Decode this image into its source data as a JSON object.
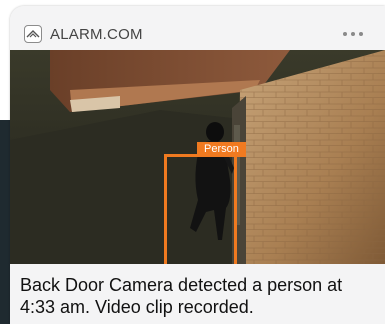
{
  "notification": {
    "app_name": "ALARM.COM",
    "app_icon": "alarm-com-logo-icon",
    "more_icon": "more-dots-icon",
    "detection_label": "Person",
    "detection_color": "#f07a20",
    "message": "Back Door Camera detected a person at 4:33 am. Video clip recorded."
  }
}
